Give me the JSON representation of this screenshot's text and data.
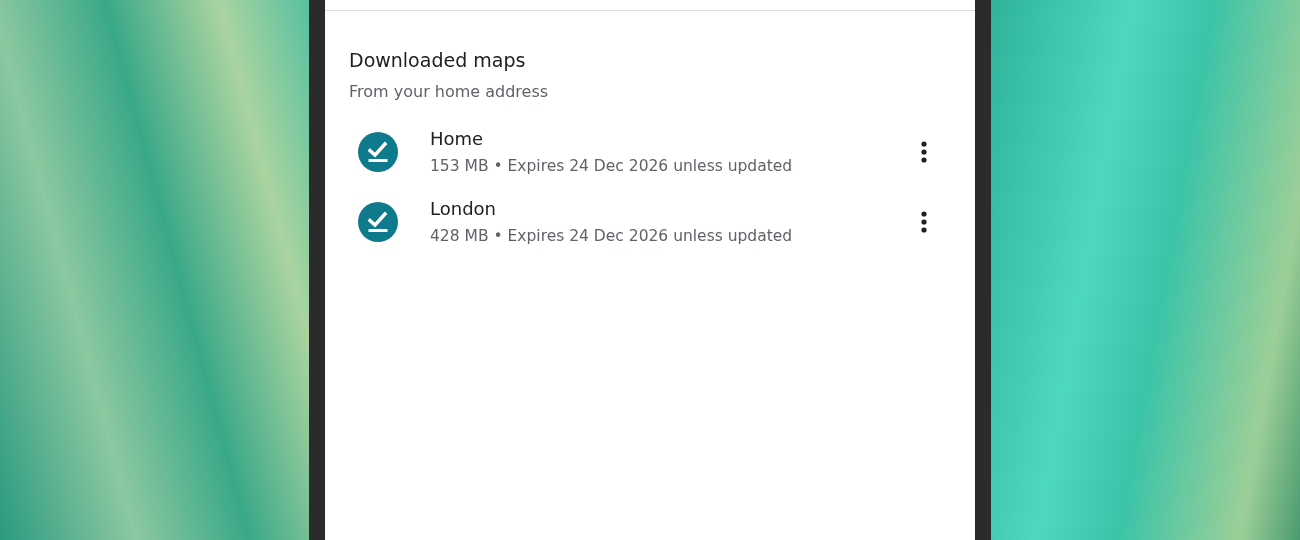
{
  "section": {
    "title": "Downloaded maps",
    "subtitle": "From your home address"
  },
  "maps": [
    {
      "name": "Home",
      "details": "153 MB • Expires 24 Dec 2026 unless updated"
    },
    {
      "name": "London",
      "details": "428 MB • Expires 24 Dec 2026 unless updated"
    }
  ]
}
